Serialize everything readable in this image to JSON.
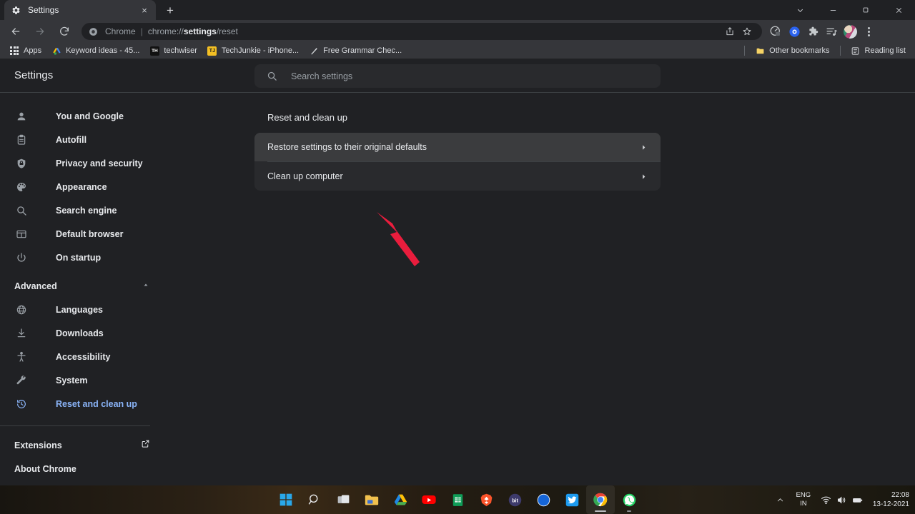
{
  "window": {
    "tab": {
      "title": "Settings",
      "favicon": "gear-icon",
      "close": "×"
    },
    "new_tab": "+",
    "controls": {
      "tab_search": "tab-search-icon",
      "minimize": "minimize-icon",
      "maximize": "maximize-icon",
      "close": "close-icon"
    }
  },
  "toolbar": {
    "back": "back-icon",
    "forward": "forward-icon",
    "reload": "reload-icon",
    "omnibox": {
      "security_icon": "chrome-page-icon",
      "scheme_label": "Chrome",
      "separator": "|",
      "url_prefix": "chrome://",
      "url_bold": "settings",
      "url_suffix": "/reset",
      "share_icon": "share-icon",
      "bookmark_icon": "star-icon"
    },
    "actions": [
      {
        "name": "speedometer-extension-icon"
      },
      {
        "name": "blue-circle-extension-icon"
      },
      {
        "name": "puzzle-extensions-icon"
      },
      {
        "name": "reading-list-icon"
      },
      {
        "name": "profile-avatar"
      },
      {
        "name": "chrome-menu-icon"
      }
    ]
  },
  "bookmarks_bar": {
    "apps_label": "Apps",
    "items": [
      {
        "label": "Keyword ideas - 45...",
        "icon": "google-ads-icon"
      },
      {
        "label": "techwiser",
        "icon": "techwiser-icon"
      },
      {
        "label": "TechJunkie - iPhone...",
        "icon": "techjunkie-icon"
      },
      {
        "label": "Free Grammar Chec...",
        "icon": "grammarly-icon"
      }
    ],
    "other_bookmarks": "Other bookmarks",
    "reading_list": "Reading list"
  },
  "settings": {
    "title": "Settings",
    "search": {
      "placeholder": "Search settings",
      "value": "",
      "icon": "search-icon"
    },
    "sidebar": {
      "items": [
        {
          "label": "You and Google",
          "icon": "person-icon",
          "active": false
        },
        {
          "label": "Autofill",
          "icon": "clipboard-icon",
          "active": false
        },
        {
          "label": "Privacy and security",
          "icon": "shield-icon",
          "active": false
        },
        {
          "label": "Appearance",
          "icon": "palette-icon",
          "active": false
        },
        {
          "label": "Search engine",
          "icon": "search-icon",
          "active": false
        },
        {
          "label": "Default browser",
          "icon": "browser-window-icon",
          "active": false
        },
        {
          "label": "On startup",
          "icon": "power-icon",
          "active": false
        }
      ],
      "advanced": {
        "label": "Advanced",
        "chevron": "chevron-up-icon",
        "expanded": true
      },
      "advanced_items": [
        {
          "label": "Languages",
          "icon": "globe-icon",
          "active": false
        },
        {
          "label": "Downloads",
          "icon": "download-icon",
          "active": false
        },
        {
          "label": "Accessibility",
          "icon": "accessibility-icon",
          "active": false
        },
        {
          "label": "System",
          "icon": "wrench-icon",
          "active": false
        },
        {
          "label": "Reset and clean up",
          "icon": "history-restore-icon",
          "active": true
        }
      ],
      "footer_items": [
        {
          "label": "Extensions",
          "external": true
        },
        {
          "label": "About Chrome",
          "external": false
        }
      ]
    },
    "main": {
      "section_title": "Reset and clean up",
      "rows": [
        {
          "label": "Restore settings to their original defaults",
          "arrow": "chevron-right-icon",
          "hovered": true
        },
        {
          "label": "Clean up computer",
          "arrow": "chevron-right-icon",
          "hovered": false
        }
      ]
    }
  },
  "annotation": {
    "type": "arrow",
    "color": "#EA1D3D",
    "points_to": "Restore settings to their original defaults"
  },
  "taskbar": {
    "items": [
      {
        "name": "start-button",
        "icon": "windows-logo-icon"
      },
      {
        "name": "search-button",
        "icon": "search-icon"
      },
      {
        "name": "task-view-button",
        "icon": "task-view-icon"
      },
      {
        "name": "file-explorer",
        "icon": "folder-icon"
      },
      {
        "name": "google-drive",
        "icon": "drive-icon"
      },
      {
        "name": "youtube",
        "icon": "youtube-icon"
      },
      {
        "name": "google-sheets",
        "icon": "sheets-icon"
      },
      {
        "name": "brave-browser",
        "icon": "brave-icon"
      },
      {
        "name": "bitly",
        "icon": "bitly-icon",
        "text": "bit"
      },
      {
        "name": "blue-app",
        "icon": "blue-circle-icon"
      },
      {
        "name": "twitter",
        "icon": "twitter-icon"
      },
      {
        "name": "google-chrome",
        "icon": "chrome-icon",
        "active": true
      },
      {
        "name": "whatsapp",
        "icon": "whatsapp-icon",
        "running": true
      }
    ],
    "tray": {
      "overflow": "chevron-up-icon",
      "language_line1": "ENG",
      "language_line2": "IN",
      "wifi": "wifi-icon",
      "volume": "volume-icon",
      "battery": "battery-icon",
      "time": "22:08",
      "date": "13-12-2021"
    }
  },
  "colors": {
    "accent": "#8ab4f8",
    "page_bg": "#202124",
    "card_bg": "#292a2d",
    "toolbar_bg": "#35363a",
    "annotation_red": "#EA1D3D"
  }
}
